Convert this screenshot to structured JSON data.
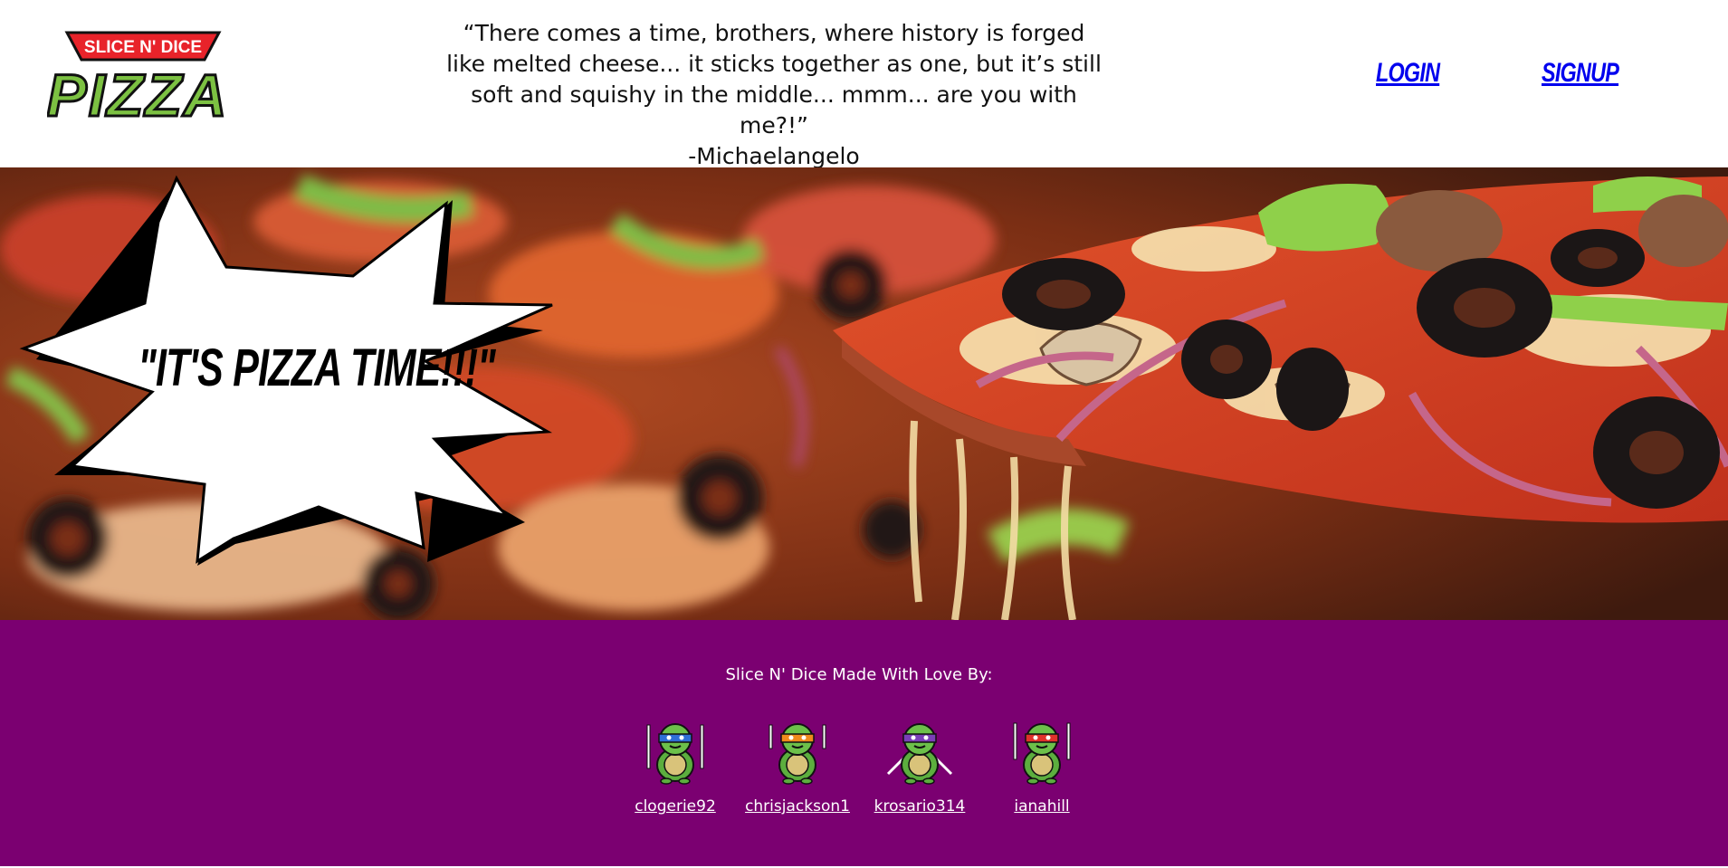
{
  "header": {
    "logo": {
      "banner_text": "SLICE N' DICE",
      "main_text": "PIZZA",
      "banner_color": "#e8232a",
      "main_color": "#7cc142"
    },
    "quote_lines": [
      "“There comes a time, brothers, where history is forged",
      "like melted cheese... it sticks together as one, but it’s still",
      "soft and squishy in the middle... mmm... are you with me?!”",
      "-Michaelangelo"
    ],
    "nav": {
      "login": "LOGIN",
      "signup": "SIGNUP"
    },
    "link_color": "#0000ee"
  },
  "hero": {
    "image": "pizza-slice-photo",
    "tagline": "\"IT'S PIZZA TIME!!!\""
  },
  "footer": {
    "background": "#7b0071",
    "heading": "Slice N' Dice Made With Love By:",
    "members": [
      {
        "username": "clogerie92",
        "avatar": "turtle-blue-mask-icon",
        "mask_color": "#2f6fd6"
      },
      {
        "username": "chrisjackson1",
        "avatar": "turtle-orange-mask-icon",
        "mask_color": "#f08a1c"
      },
      {
        "username": "krosario314",
        "avatar": "turtle-purple-mask-icon",
        "mask_color": "#7a3fb8"
      },
      {
        "username": "ianahill",
        "avatar": "turtle-red-mask-icon",
        "mask_color": "#e0312b"
      }
    ]
  }
}
